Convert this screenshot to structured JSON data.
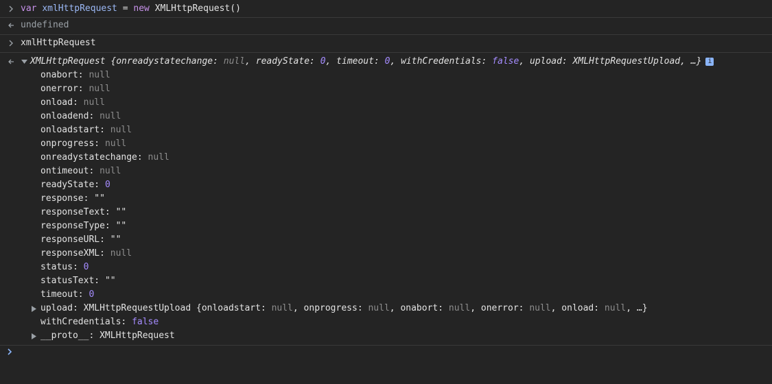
{
  "console": {
    "input1": {
      "kw_var": "var",
      "varname": "xmlHttpRequest",
      "eq": " = ",
      "kw_new": "new",
      "ctor": "XMLHttpRequest()"
    },
    "output1": "undefined",
    "input2": "xmlHttpRequest",
    "object": {
      "summary_class": "XMLHttpRequest",
      "summary_open": " {",
      "s1_key": "onreadystatechange",
      "s1_val": "null",
      "s2_key": "readyState",
      "s2_val": "0",
      "s3_key": "timeout",
      "s3_val": "0",
      "s4_key": "withCredentials",
      "s4_val": "false",
      "s5_key": "upload",
      "s5_val": "XMLHttpRequestUpload",
      "summary_close": ", …}",
      "info_badge": "i",
      "props": [
        {
          "key": "onabort",
          "value": "null",
          "type": "null"
        },
        {
          "key": "onerror",
          "value": "null",
          "type": "null"
        },
        {
          "key": "onload",
          "value": "null",
          "type": "null"
        },
        {
          "key": "onloadend",
          "value": "null",
          "type": "null"
        },
        {
          "key": "onloadstart",
          "value": "null",
          "type": "null"
        },
        {
          "key": "onprogress",
          "value": "null",
          "type": "null"
        },
        {
          "key": "onreadystatechange",
          "value": "null",
          "type": "null"
        },
        {
          "key": "ontimeout",
          "value": "null",
          "type": "null"
        },
        {
          "key": "readyState",
          "value": "0",
          "type": "num"
        },
        {
          "key": "response",
          "value": "\"\"",
          "type": "str"
        },
        {
          "key": "responseText",
          "value": "\"\"",
          "type": "str"
        },
        {
          "key": "responseType",
          "value": "\"\"",
          "type": "str"
        },
        {
          "key": "responseURL",
          "value": "\"\"",
          "type": "str"
        },
        {
          "key": "responseXML",
          "value": "null",
          "type": "null"
        },
        {
          "key": "status",
          "value": "0",
          "type": "num"
        },
        {
          "key": "statusText",
          "value": "\"\"",
          "type": "str"
        },
        {
          "key": "timeout",
          "value": "0",
          "type": "num"
        }
      ],
      "upload": {
        "key": "upload",
        "cls": "XMLHttpRequestUpload",
        "open": " {",
        "u1_key": "onloadstart",
        "u1_val": "null",
        "u2_key": "onprogress",
        "u2_val": "null",
        "u3_key": "onabort",
        "u3_val": "null",
        "u4_key": "onerror",
        "u4_val": "null",
        "u5_key": "onload",
        "u5_val": "null",
        "close": ", …}"
      },
      "withCredentials": {
        "key": "withCredentials",
        "value": "false"
      },
      "proto": {
        "key": "__proto__",
        "value": "XMLHttpRequest"
      }
    }
  }
}
